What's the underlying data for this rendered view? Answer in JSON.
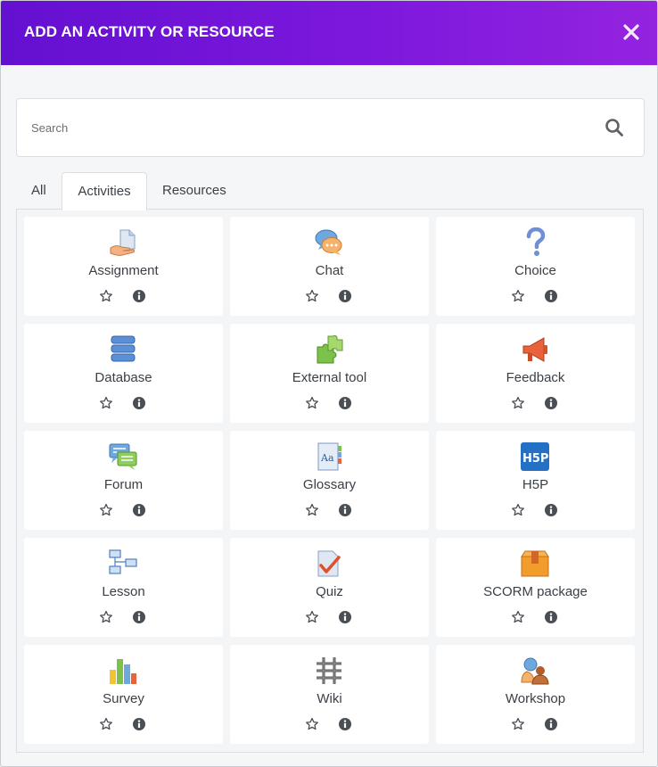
{
  "modal": {
    "title": "ADD AN ACTIVITY OR RESOURCE",
    "close_icon": "close-icon"
  },
  "search": {
    "placeholder": "Search",
    "value": "",
    "icon": "search-icon"
  },
  "tabs": [
    {
      "label": "All",
      "active": false
    },
    {
      "label": "Activities",
      "active": true
    },
    {
      "label": "Resources",
      "active": false
    }
  ],
  "activities": [
    {
      "label": "Assignment",
      "icon": "assignment-icon"
    },
    {
      "label": "Chat",
      "icon": "chat-icon"
    },
    {
      "label": "Choice",
      "icon": "choice-icon"
    },
    {
      "label": "Database",
      "icon": "database-icon"
    },
    {
      "label": "External tool",
      "icon": "external-tool-icon"
    },
    {
      "label": "Feedback",
      "icon": "feedback-icon"
    },
    {
      "label": "Forum",
      "icon": "forum-icon"
    },
    {
      "label": "Glossary",
      "icon": "glossary-icon"
    },
    {
      "label": "H5P",
      "icon": "h5p-icon"
    },
    {
      "label": "Lesson",
      "icon": "lesson-icon"
    },
    {
      "label": "Quiz",
      "icon": "quiz-icon"
    },
    {
      "label": "SCORM package",
      "icon": "scorm-package-icon"
    },
    {
      "label": "Survey",
      "icon": "survey-icon"
    },
    {
      "label": "Wiki",
      "icon": "wiki-icon"
    },
    {
      "label": "Workshop",
      "icon": "workshop-icon"
    }
  ],
  "card_actions": {
    "star_icon": "star-icon",
    "info_icon": "info-icon"
  },
  "colors": {
    "header_start": "#6410d1",
    "header_end": "#9423e0"
  }
}
